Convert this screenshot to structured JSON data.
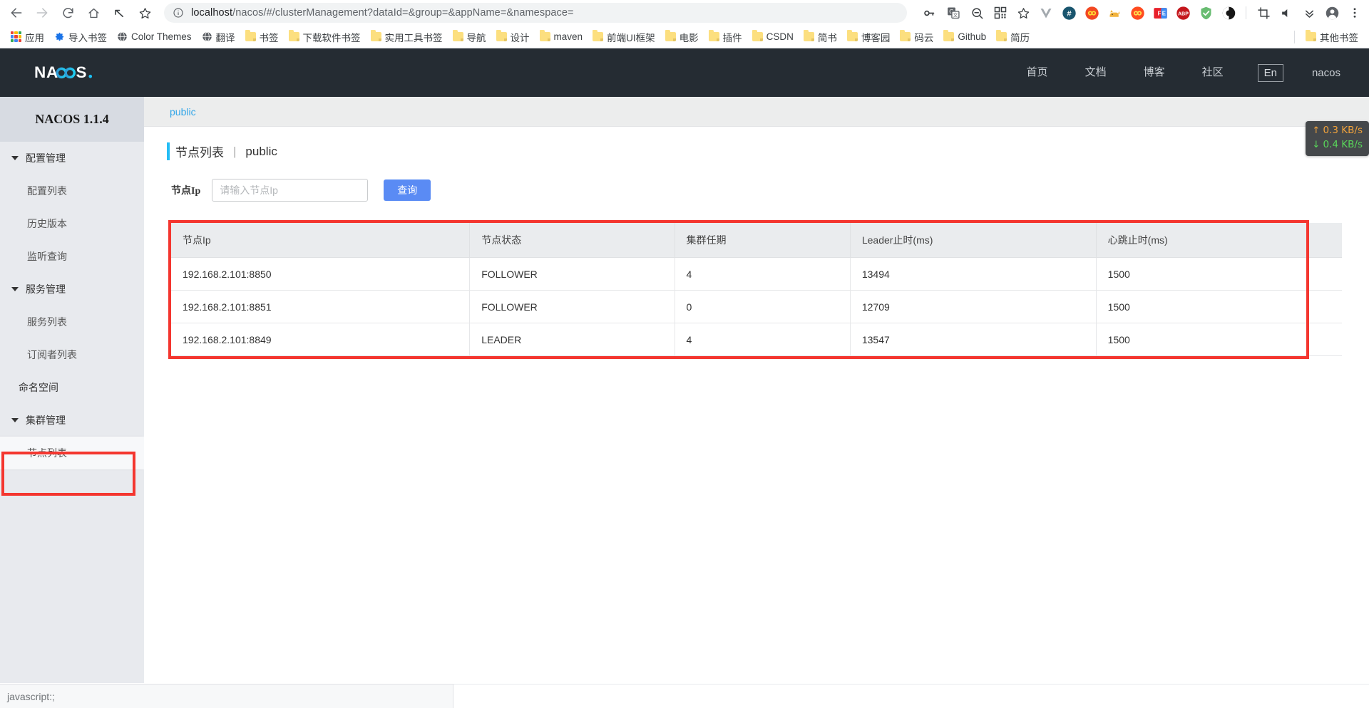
{
  "browser": {
    "nav": {
      "back": "back-arrow",
      "forward": "forward-arrow",
      "reload": "reload",
      "home": "home",
      "undo": "undo-arrow",
      "bookmark_star": "star"
    },
    "omnibox": {
      "info_icon": "info-circle-icon",
      "url_host": "localhost",
      "url_path": "/nacos/#/clusterManagement?dataId=&group=&appName=&namespace=",
      "full_url": "localhost/nacos/#/clusterManagement?dataId=&group=&appName=&namespace=",
      "actions": [
        "key-icon",
        "translate-icon",
        "zoom-out-icon",
        "qrcode-icon",
        "star-icon"
      ]
    },
    "extensions": [
      {
        "name": "vue-devtools-icon",
        "color": "#9aa0a6"
      },
      {
        "name": "hash-extension-icon",
        "color": "#1a5d7a"
      },
      {
        "name": "infinity-red-icon",
        "color": "#f04e23"
      },
      {
        "name": "cat-extension-icon",
        "color": "#f5b942"
      },
      {
        "name": "infinity-orange-icon",
        "color": "#ff5722"
      },
      {
        "name": "fe-helper-icon",
        "color": "#e8202a"
      },
      {
        "name": "adblock-plus-icon",
        "color": "#c21a1a"
      },
      {
        "name": "adguard-shield-icon",
        "color": "#68bc71"
      },
      {
        "name": "dark-reader-icon",
        "color": "#141414"
      }
    ],
    "toolbar_right": [
      "crop-icon",
      "volume-icon",
      "chevrons-down-icon",
      "profile-avatar-icon",
      "kebab-menu-icon"
    ],
    "bookmarks": [
      {
        "label": "应用",
        "icon": "apps-grid-icon"
      },
      {
        "label": "导入书签",
        "icon": "gear-icon"
      },
      {
        "label": "Color Themes",
        "icon": "globe-icon"
      },
      {
        "label": "翻译",
        "icon": "globe-icon"
      },
      {
        "label": "书签",
        "icon": "folder-icon"
      },
      {
        "label": "下载软件书签",
        "icon": "folder-icon"
      },
      {
        "label": "实用工具书签",
        "icon": "folder-icon"
      },
      {
        "label": "导航",
        "icon": "folder-icon"
      },
      {
        "label": "设计",
        "icon": "folder-icon"
      },
      {
        "label": "maven",
        "icon": "folder-icon"
      },
      {
        "label": "前端UI框架",
        "icon": "folder-icon"
      },
      {
        "label": "电影",
        "icon": "folder-icon"
      },
      {
        "label": "插件",
        "icon": "folder-icon"
      },
      {
        "label": "CSDN",
        "icon": "folder-icon"
      },
      {
        "label": "简书",
        "icon": "folder-icon"
      },
      {
        "label": "博客园",
        "icon": "folder-icon"
      },
      {
        "label": "码云",
        "icon": "folder-icon"
      },
      {
        "label": "Github",
        "icon": "folder-icon"
      },
      {
        "label": "简历",
        "icon": "folder-icon"
      }
    ],
    "other_bookmarks": {
      "label": "其他书签",
      "icon": "folder-icon"
    },
    "status_text": "javascript:;"
  },
  "header": {
    "logo_text": "NACOS.",
    "nav": [
      {
        "label": "首页"
      },
      {
        "label": "文档"
      },
      {
        "label": "博客"
      },
      {
        "label": "社区"
      }
    ],
    "lang_toggle": "En",
    "user": "nacos"
  },
  "sidebar": {
    "version_title": "NACOS 1.1.4",
    "groups": [
      {
        "label": "配置管理",
        "items": [
          {
            "label": "配置列表",
            "active": false
          },
          {
            "label": "历史版本",
            "active": false
          },
          {
            "label": "监听查询",
            "active": false
          }
        ]
      },
      {
        "label": "服务管理",
        "items": [
          {
            "label": "服务列表",
            "active": false
          },
          {
            "label": "订阅者列表",
            "active": false
          }
        ]
      }
    ],
    "standalone_item": {
      "label": "命名空间"
    },
    "cluster_group": {
      "label": "集群管理",
      "items": [
        {
          "label": "节点列表",
          "active": true
        }
      ]
    }
  },
  "main": {
    "breadcrumb": "public",
    "page_title": "节点列表",
    "page_title_sep": "|",
    "page_namespace": "public",
    "filter": {
      "label": "节点Ip",
      "placeholder": "请输入节点Ip",
      "value": "",
      "query_button": "查询"
    },
    "table": {
      "columns": [
        "节点Ip",
        "节点状态",
        "集群任期",
        "Leader止时(ms)",
        "心跳止时(ms)"
      ],
      "rows": [
        [
          "192.168.2.101:8850",
          "FOLLOWER",
          "4",
          "13494",
          "1500"
        ],
        [
          "192.168.2.101:8851",
          "FOLLOWER",
          "0",
          "12709",
          "1500"
        ],
        [
          "192.168.2.101:8849",
          "LEADER",
          "4",
          "13547",
          "1500"
        ]
      ]
    }
  },
  "net_badge": {
    "up_arrow": "↑",
    "up_value": "0.3 KB/s",
    "down_arrow": "↓",
    "down_value": "0.4 KB/s"
  },
  "colors": {
    "accent": "#24bdf5",
    "primary_button": "#5a8bf4",
    "highlight_box": "#f4362f",
    "header_bg": "#252c33",
    "link": "#33a6e8"
  }
}
